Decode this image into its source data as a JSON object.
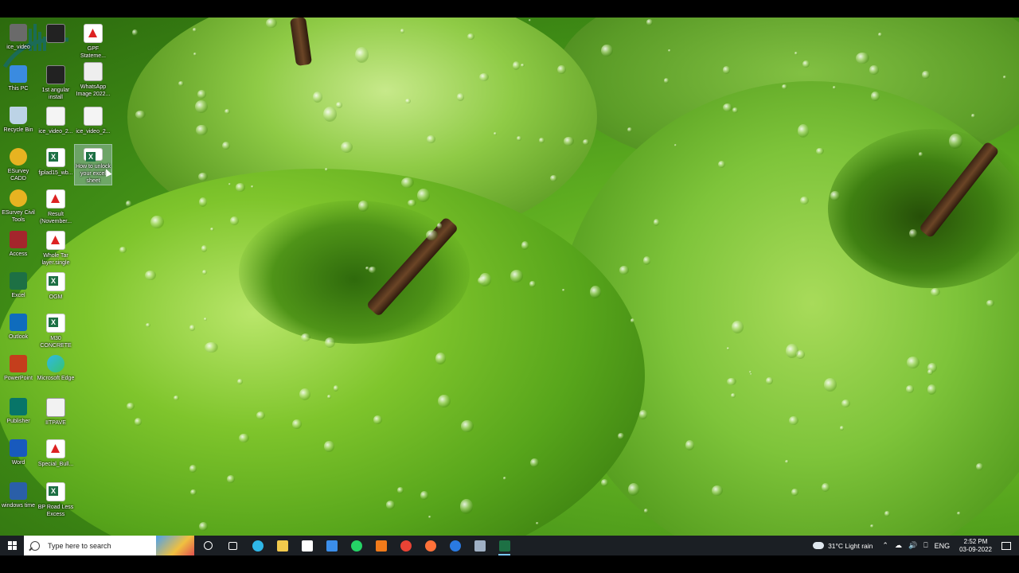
{
  "desktop": {
    "icons": [
      {
        "label": "ice_video",
        "type": "app"
      },
      {
        "label": "",
        "type": "video"
      },
      {
        "label": "GPF Stateme...",
        "type": "pdf"
      },
      {
        "label": "This PC",
        "type": "pc"
      },
      {
        "label": "1st angular install",
        "type": "video"
      },
      {
        "label": "WhatsApp Image 2022...",
        "type": "img-file"
      },
      {
        "label": "Recycle Bin",
        "type": "bin"
      },
      {
        "label": "ice_video_2...",
        "type": "file"
      },
      {
        "label": "ice_video_2...",
        "type": "file"
      },
      {
        "label": "ESurvey CADD",
        "type": "esurvey"
      },
      {
        "label": "fjplad15_wb...",
        "type": "xls"
      },
      {
        "label": "How to unlock your excel sheet",
        "type": "xls"
      },
      {
        "label": "ESurvey Civil Tools",
        "type": "esurvey"
      },
      {
        "label": "Result (November...",
        "type": "pdf"
      },
      {
        "label": "Access",
        "type": "access"
      },
      {
        "label": "Whole Tar layer.single",
        "type": "pdf"
      },
      {
        "label": "Excel",
        "type": "excel"
      },
      {
        "label": "OGM",
        "type": "xls"
      },
      {
        "label": "Outlook",
        "type": "outlook"
      },
      {
        "label": "M30 CONCRETE",
        "type": "xls"
      },
      {
        "label": "PowerPoint",
        "type": "ppt"
      },
      {
        "label": "Microsoft Edge",
        "type": "edge"
      },
      {
        "label": "Publisher",
        "type": "pub"
      },
      {
        "label": "IITPAVE",
        "type": "iitpave"
      },
      {
        "label": "Word",
        "type": "word"
      },
      {
        "label": "Special_Bull...",
        "type": "pdf"
      },
      {
        "label": "windows time",
        "type": "wintime"
      },
      {
        "label": "BP Road Less Excess",
        "type": "xls"
      }
    ]
  },
  "taskbar": {
    "search_placeholder": "Type here to search",
    "pinned": [
      {
        "name": "cortana-icon",
        "color": "#ffffff"
      },
      {
        "name": "task-view-icon",
        "color": "#ffffff"
      },
      {
        "name": "edge-icon",
        "color": "#2fb7e8"
      },
      {
        "name": "file-explorer-icon",
        "color": "#f2c94c"
      },
      {
        "name": "microsoft-store-icon",
        "color": "#ffffff"
      },
      {
        "name": "mail-icon",
        "color": "#3b8eea"
      },
      {
        "name": "whatsapp-icon",
        "color": "#25d366"
      },
      {
        "name": "snip-tool-icon",
        "color": "#f07a1a"
      },
      {
        "name": "chrome-icon",
        "color": "#e94335"
      },
      {
        "name": "firefox-icon",
        "color": "#ff7139"
      },
      {
        "name": "thunderbird-icon",
        "color": "#2a7ae2"
      },
      {
        "name": "calculator-icon",
        "color": "#9fb0c4"
      },
      {
        "name": "excel-icon",
        "color": "#1d7044"
      }
    ],
    "weather": "31°C Light rain",
    "language": "ENG",
    "time": "2:52 PM",
    "date": "03-09-2022"
  }
}
